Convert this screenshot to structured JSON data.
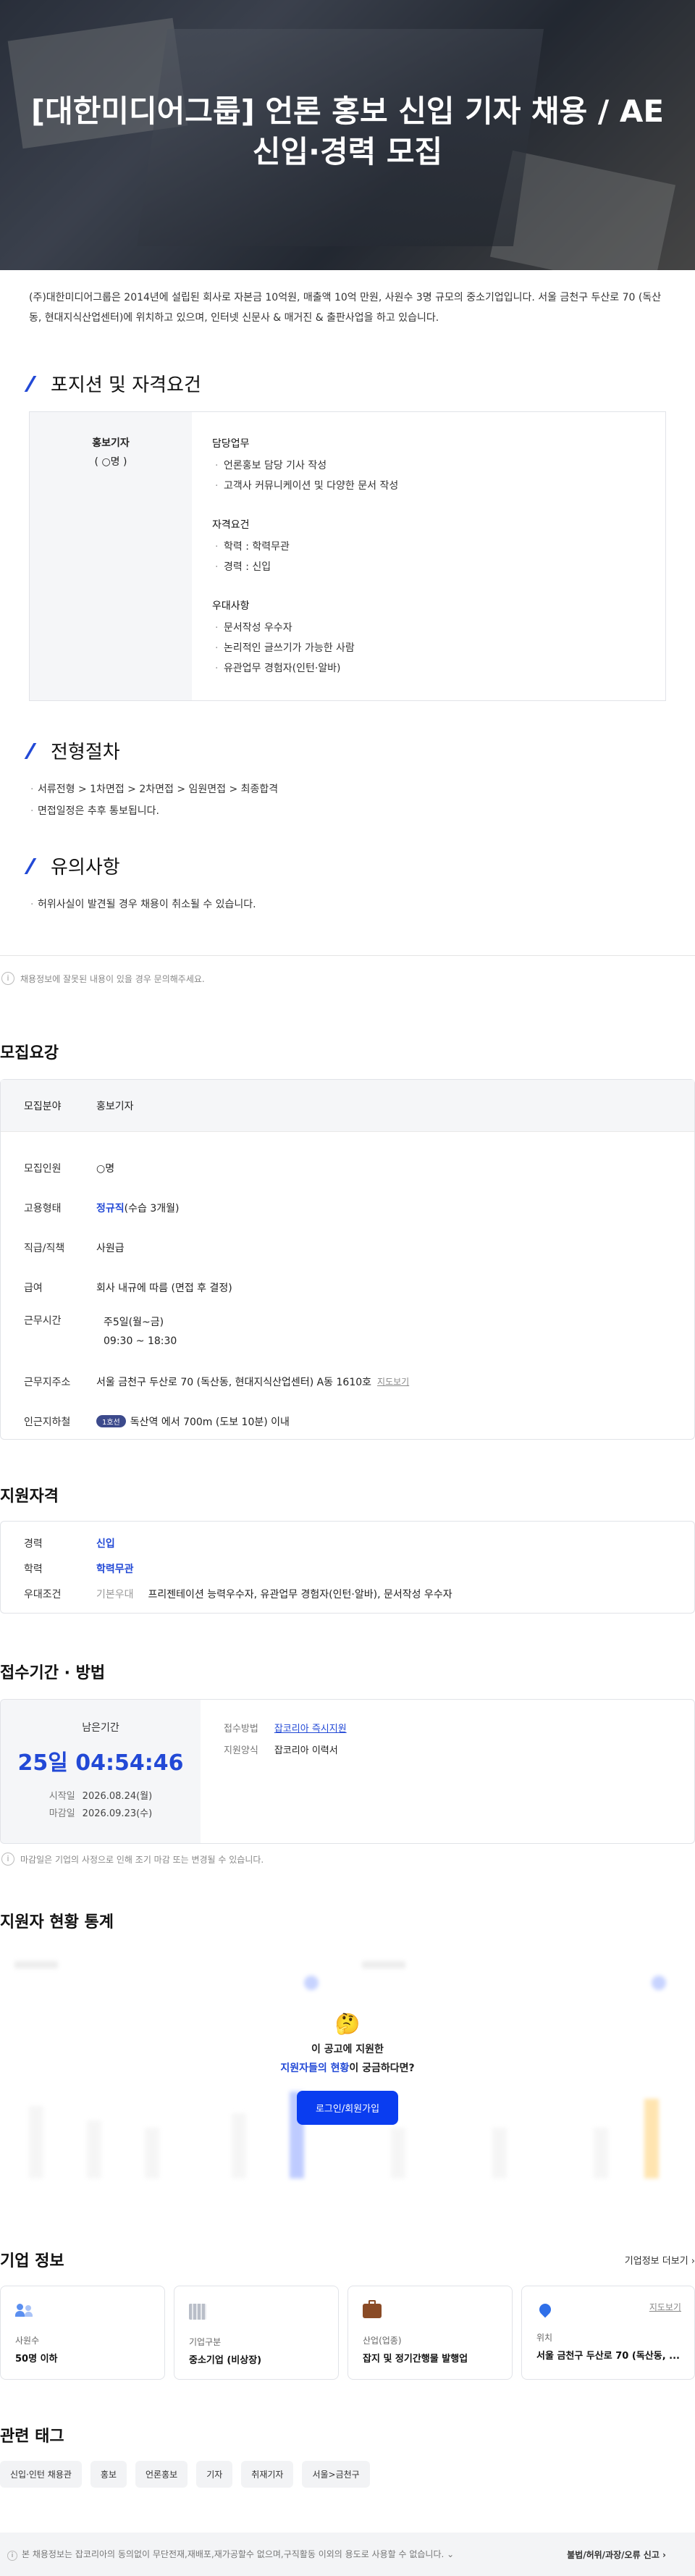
{
  "hero": {
    "title": "[대한미디어그룹] 언론 홍보 신입 기자 채용 / AE 신입·경력 모집"
  },
  "intro": "(주)대한미디어그룹은 2014년에 설립된 회사로 자본금 10억원, 매출액 10억 만원, 사원수 3명 규모의 중소기업입니다. 서울 금천구 두산로 70 (독산동, 현대지식산업센터)에 위치하고 있으며, 인터넷 신문사 & 매거진 & 출판사업을 하고 있습니다.",
  "position": {
    "section_title": "포지션 및 자격요건",
    "role": "홍보기자",
    "count": "( ○명 )",
    "groups": [
      {
        "title": "담당업무",
        "items": [
          "언론홍보 담당 기사 작성",
          "고객사 커뮤니케이션 및 다양한 문서 작성"
        ]
      },
      {
        "title": "자격요건",
        "items": [
          "학력 : 학력무관",
          "경력 : 신입"
        ]
      },
      {
        "title": "우대사항",
        "items": [
          "문서작성 우수자",
          "논리적인 글쓰기가 가능한 사람",
          "유관업무 경험자(인턴·알바)"
        ]
      }
    ]
  },
  "process": {
    "section_title": "전형절차",
    "items": [
      "서류전형 > 1차면접 > 2차면접 > 임원면접 > 최종합격",
      "면접일정은 추후 통보됩니다."
    ]
  },
  "caution": {
    "section_title": "유의사항",
    "items": [
      "허위사실이 발견될 경우 채용이 취소될 수 있습니다."
    ]
  },
  "report_notice": {
    "icon": "info-icon",
    "text": "채용정보에 잘못된 내용이 있을 경우 문의해주세요."
  },
  "summary": {
    "title": "모집요강",
    "head_key": "모집분야",
    "head_val": "홍보기자",
    "rows": [
      {
        "k": "모집인원",
        "v": "○명"
      },
      {
        "k": "고용형태",
        "v_blue": "정규직",
        "v": "(수습 3개월)"
      },
      {
        "k": "직급/직책",
        "v": "사원급"
      },
      {
        "k": "급여",
        "v": "회사 내규에 따름 (면접 후 결정)"
      },
      {
        "k": "근무시간",
        "lines": [
          "주5일(월~금)",
          "09:30 ~ 18:30"
        ]
      },
      {
        "k": "근무지주소",
        "v": "서울 금천구 두산로 70 (독산동, 현대지식산업센터) A동 1610호",
        "link": "지도보기"
      },
      {
        "k": "인근지하철",
        "badge": "1호선",
        "v": "독산역 에서 700m (도보 10분) 이내"
      }
    ]
  },
  "qualify": {
    "title": "지원자격",
    "rows": [
      {
        "k": "경력",
        "v_blue": "신입"
      },
      {
        "k": "학력",
        "v_blue": "학력무관"
      },
      {
        "k": "우대조건",
        "sub": "기본우대",
        "v": "프리젠테이션 능력우수자, 유관업무 경험자(인턴·알바), 문서작성 우수자"
      }
    ]
  },
  "apply": {
    "title": "접수기간 · 방법",
    "remaining_label": "남은기간",
    "remaining": "25일 04:54:46",
    "start_label": "시작일",
    "start": "2026.08.24(월)",
    "end_label": "마감일",
    "end": "2026.09.23(수)",
    "method_label": "접수방법",
    "method": "잡코리아 즉시지원",
    "form_label": "지원양식",
    "form": "잡코리아 이력서",
    "notice": "마감일은 기업의 사정으로 인해 조기 마감 또는 변경될 수 있습니다."
  },
  "stats": {
    "title": "지원자 현황 통계",
    "q1": "이 공고에 지원한",
    "q2_blue": "지원자들의 현황",
    "q2_rest": "이 궁금하다면?",
    "button": "로그인/회원가입",
    "emoji": "🤔"
  },
  "company": {
    "title": "기업 정보",
    "more": "기업정보 더보기",
    "cards": [
      {
        "icon": "people-icon",
        "label": "사원수",
        "value": "50명 이하"
      },
      {
        "icon": "building-icon",
        "label": "기업구분",
        "value": "중소기업 (비상장)"
      },
      {
        "icon": "briefcase-icon",
        "label": "산업(업종)",
        "value": "잡지 및 정기간행물 발행업"
      },
      {
        "icon": "pin-icon",
        "label": "위치",
        "value": "서울 금천구 두산로 70 (독산동, ...",
        "link": "지도보기"
      }
    ]
  },
  "tags": {
    "title": "관련 태그",
    "items": [
      "신입·인턴 채용관",
      "홍보",
      "언론홍보",
      "기자",
      "취재기자",
      "서울>금천구"
    ]
  },
  "footer": {
    "left": "본 채용정보는 잡코리아의 동의없이 무단전재,재배포,재가공할수 없으며,구직활동 이외의 용도로 사용할 수 없습니다.",
    "right": "불법/허위/과장/오류 신고"
  },
  "colors": {
    "accent": "#2249d6",
    "button": "#0a3df0",
    "subway": "#3c4a8c"
  }
}
